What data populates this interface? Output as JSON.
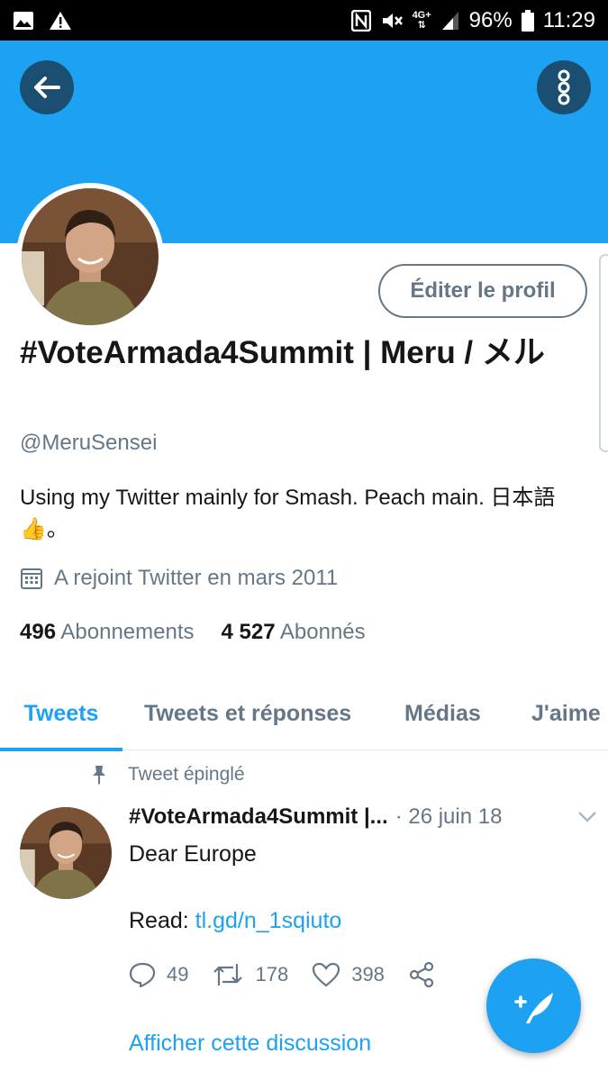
{
  "status_bar": {
    "battery": "96%",
    "time": "11:29",
    "network": "4G+"
  },
  "header": {
    "back_icon": "arrow-left-icon",
    "more_icon": "vertical-dots-icon",
    "banner_color": "#1da1f2"
  },
  "profile": {
    "edit_label": "Éditer le profil",
    "display_name": "#VoteArmada4Summit | Meru / メル",
    "handle": "@MeruSensei",
    "bio": "Using my Twitter mainly for Smash. Peach main. 日本語👍。",
    "joined": "A rejoint Twitter en mars 2011",
    "following_count": "496",
    "following_label": "Abonnements",
    "followers_count": "4 527",
    "followers_label": "Abonnés"
  },
  "tabs": [
    {
      "label": "Tweets",
      "active": true
    },
    {
      "label": "Tweets et réponses",
      "active": false
    },
    {
      "label": "Médias",
      "active": false
    },
    {
      "label": "J'aime",
      "active": false
    }
  ],
  "tweet": {
    "pinned_label": "Tweet épinglé",
    "author": "#VoteArmada4Summit |...",
    "date": "· 26 juin 18",
    "text": "Dear Europe",
    "read_prefix": "Read: ",
    "link": "tl.gd/n_1sqiuto",
    "replies": "49",
    "retweets": "178",
    "likes": "398",
    "show_thread": "Afficher cette discussion"
  },
  "colors": {
    "accent": "#1da1f2",
    "text_secondary": "#657786"
  }
}
